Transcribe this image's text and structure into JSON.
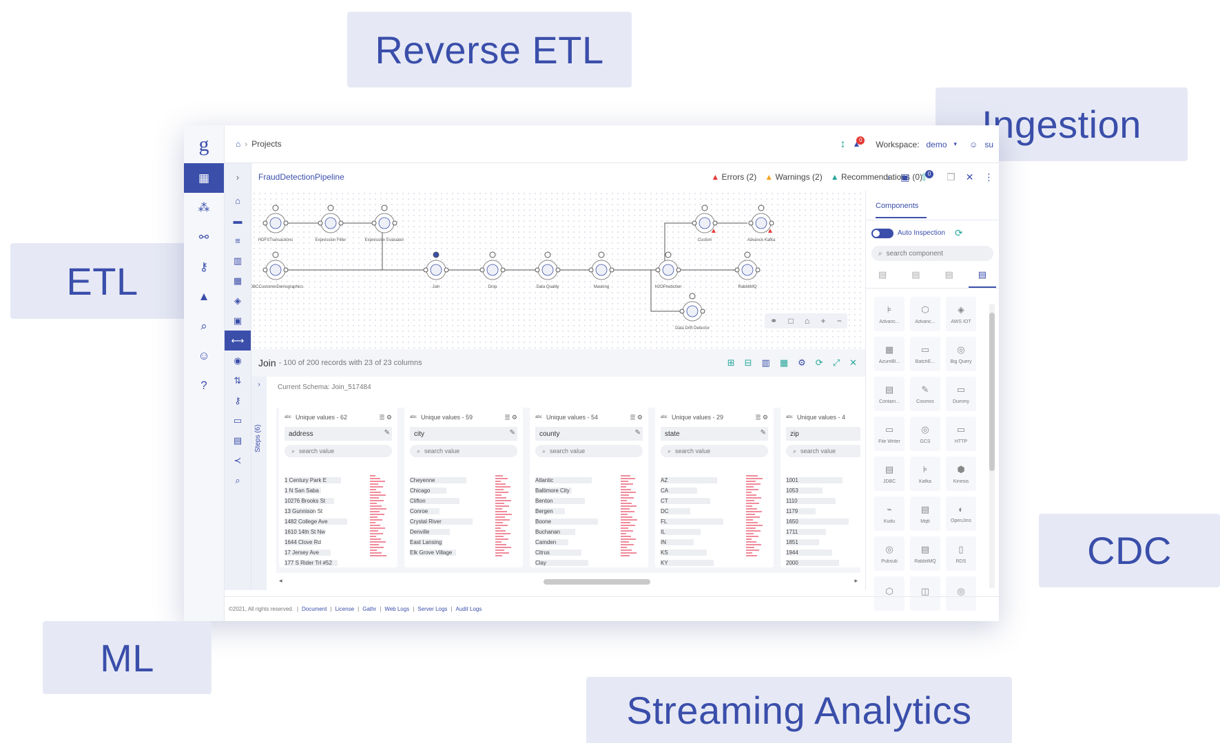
{
  "pills": {
    "reverse_etl": "Reverse ETL",
    "ingestion": "Ingestion",
    "etl": "ETL",
    "cdc": "CDC",
    "ml": "ML",
    "streaming": "Streaming Analytics"
  },
  "topbar": {
    "logo": "g",
    "breadcrumb": "Projects",
    "notifications": "0",
    "workspace_label": "Workspace:",
    "workspace_value": "demo",
    "user": "su"
  },
  "pipeline": {
    "name": "FraudDetectionPipeline",
    "errors": "Errors (2)",
    "warnings": "Warnings (2)",
    "recommendations": "Recommendations (0)",
    "publish_badge": "0",
    "nodes": [
      "HDFSTransactions",
      "Expression Filter",
      "Expression Evaluator",
      "JDBCCustomerDemographics",
      "Join",
      "Drop",
      "Data Quality",
      "Masking",
      "H2OPrediction",
      "Custom",
      "Advance Kafka",
      "RabbitMQ",
      "Data Drift Detector"
    ]
  },
  "components": {
    "tab": "Components",
    "auto_inspection": "Auto Inspection",
    "search_placeholder": "search component",
    "items": [
      "Advanc...",
      "Advanc...",
      "AWS IOT",
      "AzureBl...",
      "BatchE...",
      "Big Query",
      "Contain...",
      "Cosmos",
      "Dummy",
      "File Writer",
      "GCS",
      "HTTP",
      "JDBC",
      "Kafka",
      "Kinesis",
      "Kudu",
      "Mqtt",
      "OpenJms",
      "Pubsub",
      "RabbitMQ",
      "RDS",
      "",
      "",
      ""
    ]
  },
  "join": {
    "title": "Join",
    "subtitle": "- 100 of 200 records with 23 of 23 columns",
    "steps": "Steps (6)",
    "schema": "Current Schema: Join_517484",
    "search_placeholder": "search value",
    "columns": [
      {
        "unique": "Unique values - 62",
        "name": "address",
        "values": [
          "1 Century Park E",
          "1 N San Saba",
          "10276 Brooks St",
          "13 Gunnison St",
          "1482 College Ave",
          "1610 14th St Nw",
          "1644 Clove Rd",
          "17 Jersey Ave",
          "177 S Rider Trl #52"
        ]
      },
      {
        "unique": "Unique values - 59",
        "name": "city",
        "values": [
          "Cheyenne",
          "Chicago",
          "Clifton",
          "Conroe",
          "Crystal River",
          "Denville",
          "East Lansing",
          "Elk Grove Village"
        ]
      },
      {
        "unique": "Unique values - 54",
        "name": "county",
        "values": [
          "Atlantic",
          "Baltimore City",
          "Benton",
          "Bergen",
          "Boone",
          "Buchanan",
          "Camden",
          "Citrus",
          "Clay"
        ]
      },
      {
        "unique": "Unique values - 29",
        "name": "state",
        "values": [
          "AZ",
          "CA",
          "CT",
          "DC",
          "FL",
          "IL",
          "IN",
          "KS",
          "KY"
        ]
      },
      {
        "unique": "Unique values - 4",
        "name": "zip",
        "values": [
          "1001",
          "1053",
          "1110",
          "1179",
          "1650",
          "1711",
          "1851",
          "1944",
          "2000"
        ]
      }
    ]
  },
  "footer": {
    "copyright": "©2021, All rights reserved.",
    "links": [
      "Document",
      "License",
      "Gathr",
      "Web Logs",
      "Server Logs",
      "Audit Logs"
    ]
  },
  "colors": {
    "brand": "#3a4eaa",
    "pill_bg": "#e6e9f5",
    "error": "#e53935",
    "warning": "#f5a623",
    "recommendation": "#26a69a"
  }
}
